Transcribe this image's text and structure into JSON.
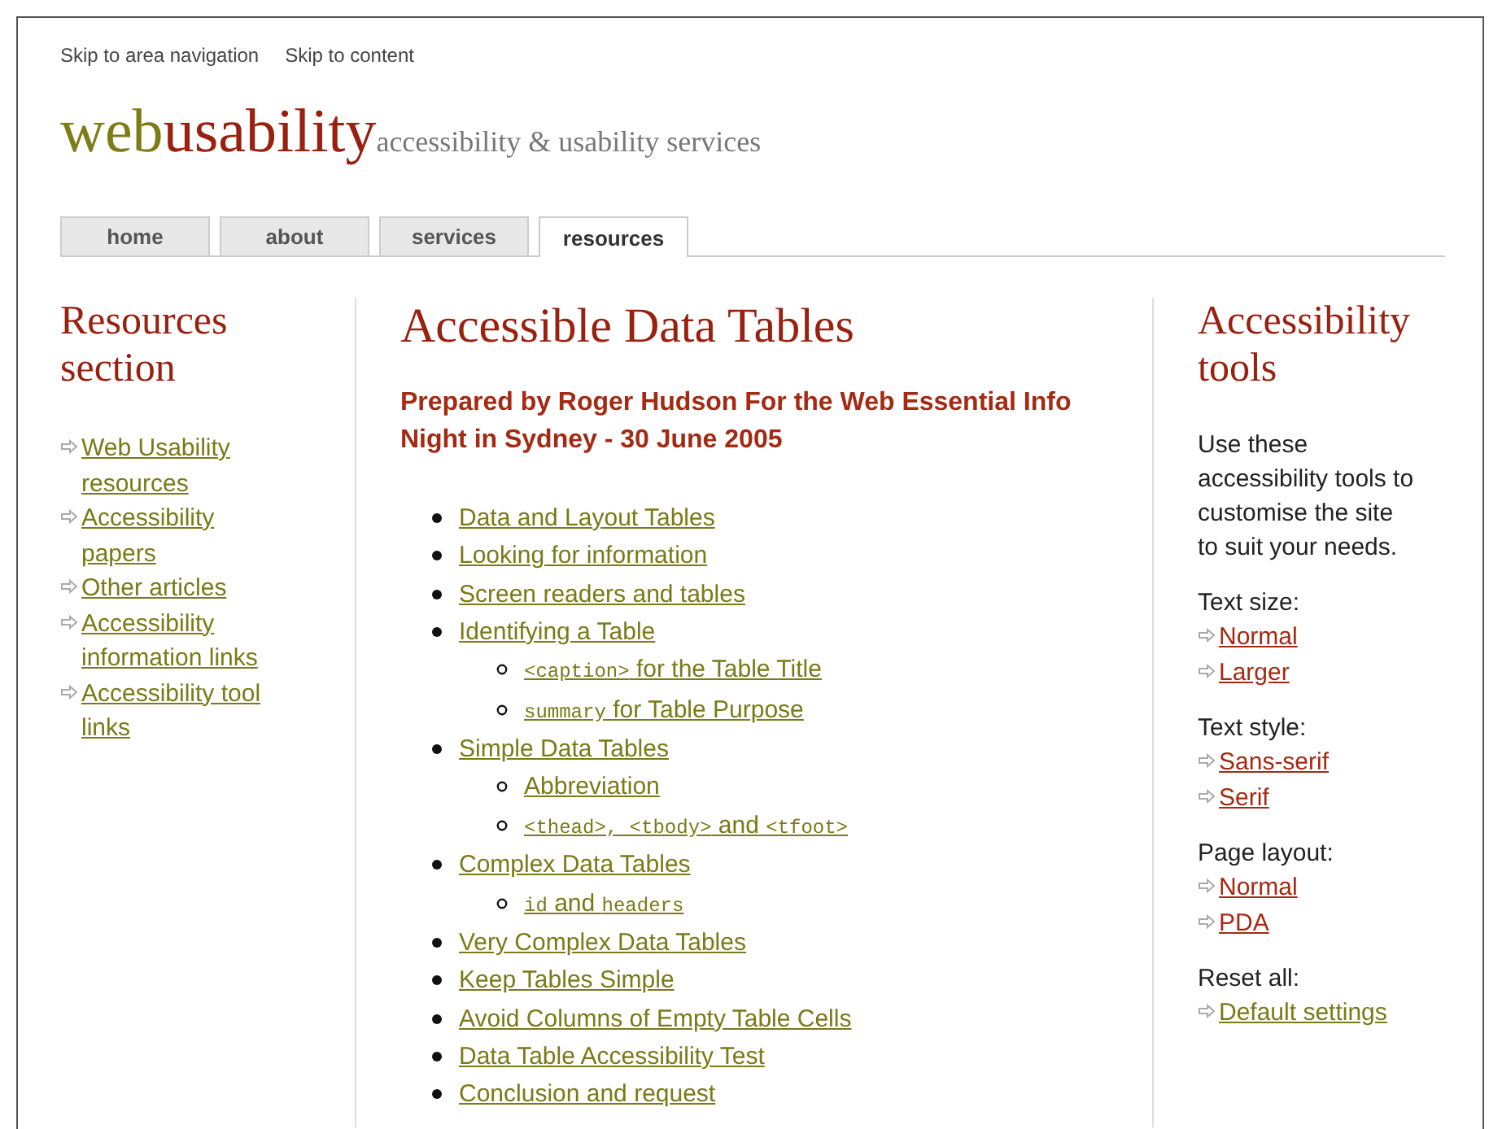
{
  "skip_links": [
    "Skip to area navigation",
    "Skip to content"
  ],
  "logo": {
    "part_1": "web",
    "part_2": "usability",
    "tagline": "accessibility & usability services"
  },
  "tabs": [
    {
      "label": "home",
      "selected": false
    },
    {
      "label": "about",
      "selected": false
    },
    {
      "label": "services",
      "selected": false
    },
    {
      "label": "resources",
      "selected": true
    }
  ],
  "sidebar": {
    "title": "Resources section",
    "items": [
      "Web Usability resources",
      "Accessibility papers",
      "Other articles",
      "Accessibility information links",
      "Accessibility tool links"
    ]
  },
  "main": {
    "title": "Accessible Data Tables",
    "subtitle": "Prepared by Roger Hudson For the Web Essential Info Night in Sydney - 30 June 2005",
    "contents": [
      {
        "parts": [
          {
            "kind": "text",
            "text": "Data and Layout Tables"
          }
        ]
      },
      {
        "parts": [
          {
            "kind": "text",
            "text": "Looking for information"
          }
        ]
      },
      {
        "parts": [
          {
            "kind": "text",
            "text": "Screen readers and tables"
          }
        ]
      },
      {
        "parts": [
          {
            "kind": "text",
            "text": "Identifying a Table"
          }
        ],
        "children": [
          {
            "parts": [
              {
                "kind": "code",
                "text": "<caption>"
              },
              {
                "kind": "text",
                "text": " for the Table Title"
              }
            ]
          },
          {
            "parts": [
              {
                "kind": "code",
                "text": "summary"
              },
              {
                "kind": "text",
                "text": " for Table Purpose"
              }
            ]
          }
        ]
      },
      {
        "parts": [
          {
            "kind": "text",
            "text": "Simple Data Tables"
          }
        ],
        "children": [
          {
            "parts": [
              {
                "kind": "text",
                "text": "Abbreviation"
              }
            ]
          },
          {
            "parts": [
              {
                "kind": "code",
                "text": "<thead>, <tbody>"
              },
              {
                "kind": "text",
                "text": " and "
              },
              {
                "kind": "code",
                "text": "<tfoot>"
              }
            ]
          }
        ]
      },
      {
        "parts": [
          {
            "kind": "text",
            "text": "Complex Data Tables"
          }
        ],
        "children": [
          {
            "parts": [
              {
                "kind": "code",
                "text": "id"
              },
              {
                "kind": "text",
                "text": " and "
              },
              {
                "kind": "code",
                "text": "headers"
              }
            ]
          }
        ]
      },
      {
        "parts": [
          {
            "kind": "text",
            "text": "Very Complex Data Tables"
          }
        ]
      },
      {
        "parts": [
          {
            "kind": "text",
            "text": "Keep Tables Simple"
          }
        ]
      },
      {
        "parts": [
          {
            "kind": "text",
            "text": "Avoid Columns of Empty Table Cells"
          }
        ]
      },
      {
        "parts": [
          {
            "kind": "text",
            "text": "Data Table Accessibility Test"
          }
        ]
      },
      {
        "parts": [
          {
            "kind": "text",
            "text": "Conclusion and request"
          }
        ]
      }
    ]
  },
  "tools": {
    "title": "Accessibility tools",
    "intro": "Use these accessibility tools to customise the site to suit your needs.",
    "groups": [
      {
        "label": "Text size:",
        "links": [
          {
            "text": "Normal",
            "color": "#a52a14"
          },
          {
            "text": "Larger",
            "color": "#a52a14"
          }
        ]
      },
      {
        "label": "Text style:",
        "links": [
          {
            "text": "Sans-serif",
            "color": "#a52a14"
          },
          {
            "text": "Serif",
            "color": "#a52a14"
          }
        ]
      },
      {
        "label": "Page layout:",
        "links": [
          {
            "text": "Normal",
            "color": "#a52a14"
          },
          {
            "text": "PDA",
            "color": "#a52a14"
          }
        ]
      },
      {
        "label": "Reset all:",
        "links": [
          {
            "text": "Default settings",
            "color": "#7a7a18"
          }
        ]
      }
    ]
  }
}
